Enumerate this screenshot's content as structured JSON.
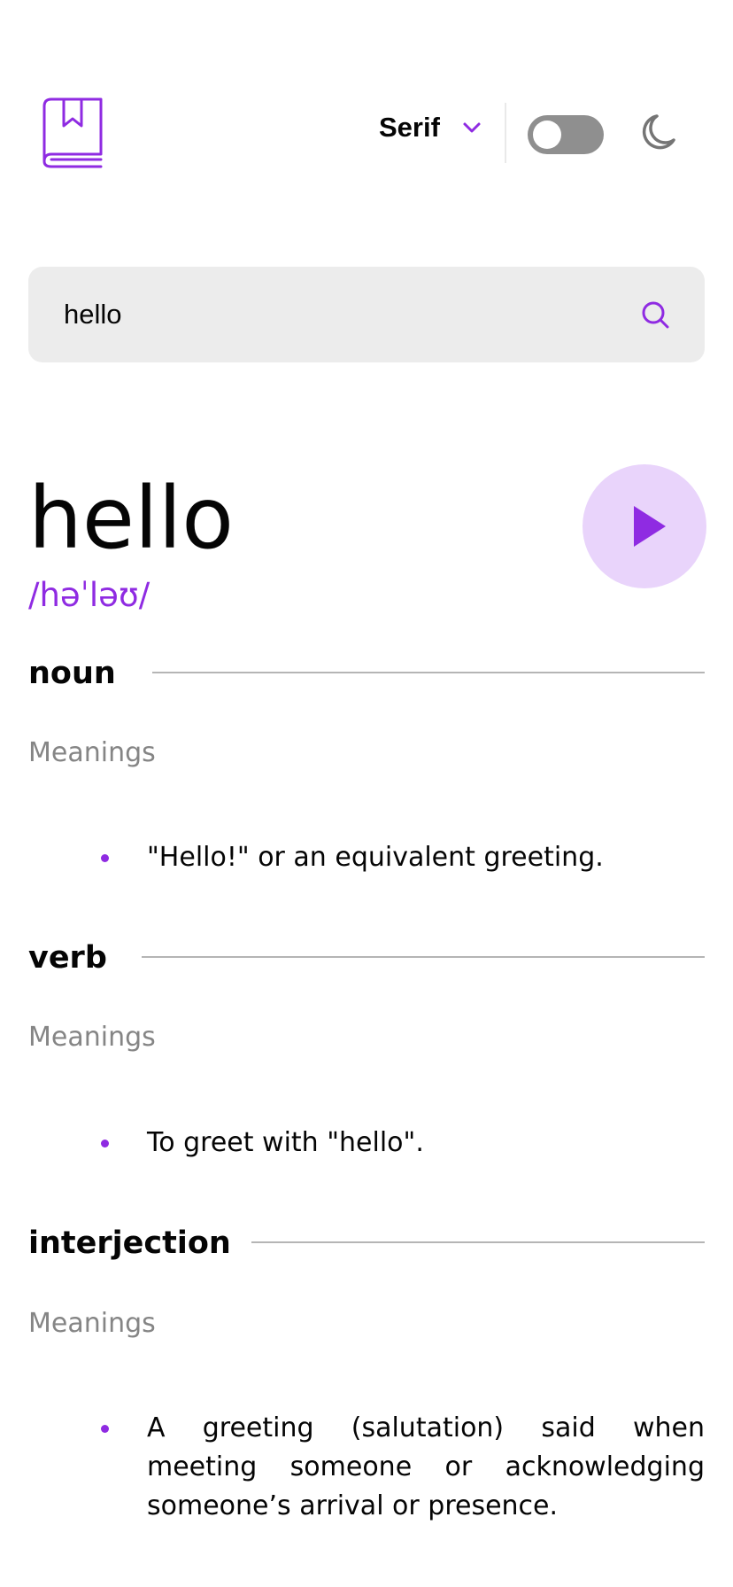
{
  "header": {
    "logo_icon": "book-icon",
    "font_selector": {
      "selected": "Serif",
      "chevron_icon": "chevron-down-icon"
    },
    "theme_toggle": {
      "state": "off"
    },
    "theme_icon": "moon-icon"
  },
  "search": {
    "value": "hello",
    "placeholder": "",
    "icon": "search-icon"
  },
  "entry": {
    "word": "hello",
    "phonetic": "/həˈləʊ/",
    "play_icon": "play-icon"
  },
  "meanings": [
    {
      "part_of_speech": "noun",
      "heading": "Meanings",
      "definitions": [
        "\"Hello!\" or an equivalent greeting."
      ]
    },
    {
      "part_of_speech": "verb",
      "heading": "Meanings",
      "definitions": [
        "To greet with \"hello\"."
      ]
    },
    {
      "part_of_speech": "interjection",
      "heading": "Meanings",
      "definitions": [
        "A greeting (salutation) said when meeting someone or acknowledging someone’s arrival or presence."
      ]
    }
  ],
  "colors": {
    "accent": "#8f2be2",
    "accent_light": "#e9d4fb",
    "search_bg": "#ececec",
    "muted_text": "#858585",
    "divider": "#b5b5b5",
    "toggle_off": "#8f8f8f"
  }
}
